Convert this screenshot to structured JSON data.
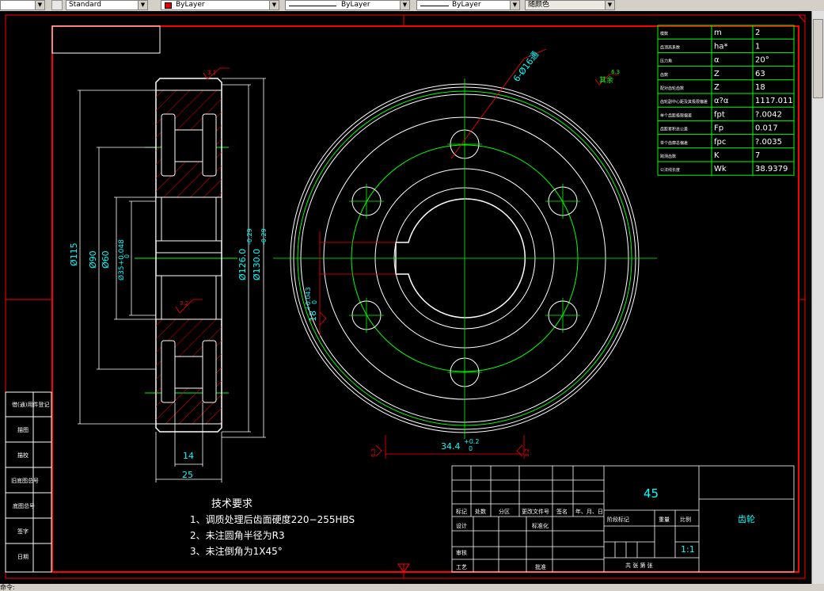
{
  "toolbar": {
    "textstyle_value": "Standard",
    "layer_color_value": "ByLayer",
    "linetype_value": "ByLayer",
    "lineweight_value": "ByLayer",
    "plotstyle_value": "随颜色"
  },
  "status": {
    "command_prompt": "命令:"
  },
  "drawing": {
    "param_table": [
      [
        "模数",
        "m",
        "2"
      ],
      [
        "齿顶高系数",
        "ha*",
        "1"
      ],
      [
        "压力角",
        "α",
        "20°"
      ],
      [
        "齿数",
        "Z",
        "63"
      ],
      [
        "配对齿轮齿数",
        "Z",
        "18"
      ],
      [
        "齿轮副中心距及其极限偏差",
        "α?α",
        "1117.011"
      ],
      [
        "单个齿距极限偏差",
        "fpt",
        "?.0042"
      ],
      [
        "齿距累积总公差",
        "Fp",
        "0.017"
      ],
      [
        "单个齿廓总偏差",
        "fpc",
        "?.0035"
      ],
      [
        "跨测齿数",
        "K",
        "7"
      ],
      [
        "公法线长度",
        "Wk",
        "38.9379"
      ]
    ],
    "dims": {
      "d115": "Ø115",
      "d90": "Ø90",
      "d60": "Ø60",
      "d35": "Ø35+0.048",
      "d35_low": "0",
      "d126": "Ø126.0",
      "d126_tol": "-0.29",
      "d130": "Ø130.0",
      "d130_tol": "-0.29",
      "dim14": "14",
      "dim25": "25",
      "keyway_width": "18",
      "keyway_tol": "+0.043",
      "keyway_tol_low": "0",
      "keyway_depth": "34.4",
      "keyway_depth_tol": "+0.2",
      "keyway_depth_tol_low": "0",
      "holes": "6-Ø16通",
      "rough_1": "3.2",
      "rough_2": "3.2",
      "rough_3": "6.3",
      "rough_4": "6.3",
      "rough_5": "3.2",
      "rough_rest": "其余",
      "rough_rest_val": "6.3"
    },
    "tech_req": {
      "title": "技术要求",
      "line1": "1、调质处理后齿面硬度220−255HBS",
      "line2": "2、未注圆角半径为R3",
      "line3": "3、未注倒角为1X45°"
    },
    "title_block": {
      "material": "45",
      "part_name": "齿轮",
      "scale": "1:1",
      "header_row": [
        "标记",
        "处数",
        "分区",
        "更改文件号",
        "签名",
        "年、月、日"
      ],
      "design": "设计",
      "standardize": "标准化",
      "stage_mark": "阶段标记",
      "weight": "重量",
      "ratio": "比例",
      "review": "审核",
      "process": "工艺",
      "approve": "批准",
      "sheets": "共  张  第  张"
    },
    "left_strip": [
      "借(通)用件登记",
      "描图",
      "描校",
      "旧底图总号",
      "底图总号",
      "签字",
      "日期"
    ]
  },
  "colors": {
    "frame": "#ff0000",
    "lines": "#ffffff",
    "dims": "#00ffff",
    "centerlines": "#00ff00",
    "hatch": "#ff0000",
    "toolbar": "#d4d0c8"
  }
}
